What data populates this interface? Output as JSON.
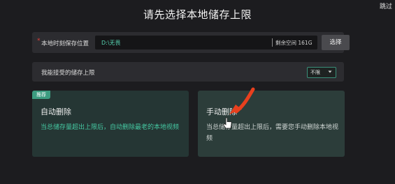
{
  "header": {
    "skip_label": "跳过",
    "title": "请先选择本地储存上限"
  },
  "save_location": {
    "required_mark": "*",
    "label": "本地时刻保存位置",
    "path_value": "D:\\无畏",
    "free_space": "剩余空间 161G",
    "select_button": "选择"
  },
  "storage_limit": {
    "label": "我能接受的储存上限",
    "selected": "不限",
    "dropdown_icon": "chevron-down-icon"
  },
  "options": {
    "auto": {
      "badge": "推荐",
      "title": "自动删除",
      "description": "当总储存量超出上限后，自动删除最老的本地视频"
    },
    "manual": {
      "title": "手动删除",
      "description": "当总储存量超出上限后，需要您手动删除本地视频"
    }
  },
  "colors": {
    "background": "#1c1c1f",
    "accent": "#45c8a2",
    "annotation_arrow": "#e8401e",
    "required": "#e0403a"
  }
}
